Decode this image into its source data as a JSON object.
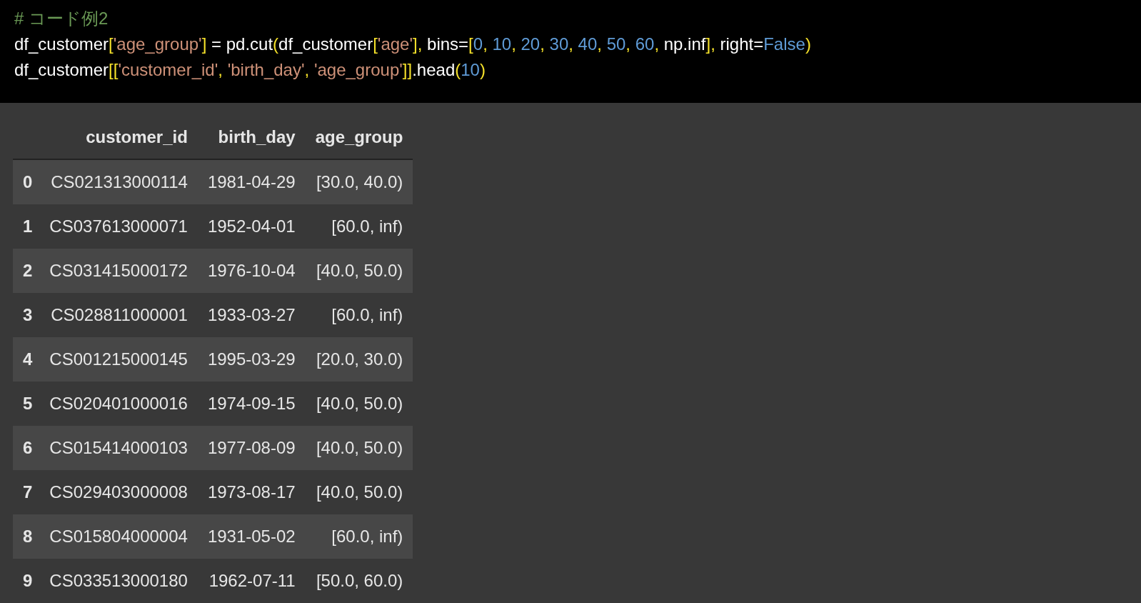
{
  "code_cell": {
    "lines": [
      [
        {
          "kind": "comment",
          "text": "# コード例2"
        }
      ],
      [
        {
          "kind": "name",
          "text": "df_customer"
        },
        {
          "kind": "bracket",
          "text": "["
        },
        {
          "kind": "string",
          "text": "'age_group'"
        },
        {
          "kind": "bracket",
          "text": "]"
        },
        {
          "kind": "name",
          "text": " = pd.cut"
        },
        {
          "kind": "bracket",
          "text": "("
        },
        {
          "kind": "name",
          "text": "df_customer"
        },
        {
          "kind": "bracket",
          "text": "["
        },
        {
          "kind": "string",
          "text": "'age'"
        },
        {
          "kind": "bracket",
          "text": "],"
        },
        {
          "kind": "name",
          "text": " bins="
        },
        {
          "kind": "bracket",
          "text": "["
        },
        {
          "kind": "number",
          "text": "0"
        },
        {
          "kind": "bracket",
          "text": ", "
        },
        {
          "kind": "number",
          "text": "10"
        },
        {
          "kind": "bracket",
          "text": ", "
        },
        {
          "kind": "number",
          "text": "20"
        },
        {
          "kind": "bracket",
          "text": ", "
        },
        {
          "kind": "number",
          "text": "30"
        },
        {
          "kind": "bracket",
          "text": ", "
        },
        {
          "kind": "number",
          "text": "40"
        },
        {
          "kind": "bracket",
          "text": ", "
        },
        {
          "kind": "number",
          "text": "50"
        },
        {
          "kind": "bracket",
          "text": ", "
        },
        {
          "kind": "number",
          "text": "60"
        },
        {
          "kind": "bracket",
          "text": ","
        },
        {
          "kind": "name",
          "text": " np.inf"
        },
        {
          "kind": "bracket",
          "text": "],"
        },
        {
          "kind": "name",
          "text": " right="
        },
        {
          "kind": "number",
          "text": "False"
        },
        {
          "kind": "bracket",
          "text": ")"
        }
      ],
      [
        {
          "kind": "name",
          "text": "df_customer"
        },
        {
          "kind": "bracket",
          "text": "[["
        },
        {
          "kind": "string",
          "text": "'customer_id'"
        },
        {
          "kind": "bracket",
          "text": ", "
        },
        {
          "kind": "string",
          "text": "'birth_day'"
        },
        {
          "kind": "bracket",
          "text": ", "
        },
        {
          "kind": "string",
          "text": "'age_group'"
        },
        {
          "kind": "bracket",
          "text": "]]"
        },
        {
          "kind": "name",
          "text": ".head"
        },
        {
          "kind": "bracket",
          "text": "("
        },
        {
          "kind": "number",
          "text": "10"
        },
        {
          "kind": "bracket",
          "text": ")"
        }
      ]
    ]
  },
  "table": {
    "columns": [
      "customer_id",
      "birth_day",
      "age_group"
    ],
    "rows": [
      {
        "index": "0",
        "cells": [
          "CS021313000114",
          "1981-04-29",
          "[30.0, 40.0)"
        ]
      },
      {
        "index": "1",
        "cells": [
          "CS037613000071",
          "1952-04-01",
          "[60.0, inf)"
        ]
      },
      {
        "index": "2",
        "cells": [
          "CS031415000172",
          "1976-10-04",
          "[40.0, 50.0)"
        ]
      },
      {
        "index": "3",
        "cells": [
          "CS028811000001",
          "1933-03-27",
          "[60.0, inf)"
        ]
      },
      {
        "index": "4",
        "cells": [
          "CS001215000145",
          "1995-03-29",
          "[20.0, 30.0)"
        ]
      },
      {
        "index": "5",
        "cells": [
          "CS020401000016",
          "1974-09-15",
          "[40.0, 50.0)"
        ]
      },
      {
        "index": "6",
        "cells": [
          "CS015414000103",
          "1977-08-09",
          "[40.0, 50.0)"
        ]
      },
      {
        "index": "7",
        "cells": [
          "CS029403000008",
          "1973-08-17",
          "[40.0, 50.0)"
        ]
      },
      {
        "index": "8",
        "cells": [
          "CS015804000004",
          "1931-05-02",
          "[60.0, inf)"
        ]
      },
      {
        "index": "9",
        "cells": [
          "CS033513000180",
          "1962-07-11",
          "[50.0, 60.0)"
        ]
      }
    ]
  }
}
